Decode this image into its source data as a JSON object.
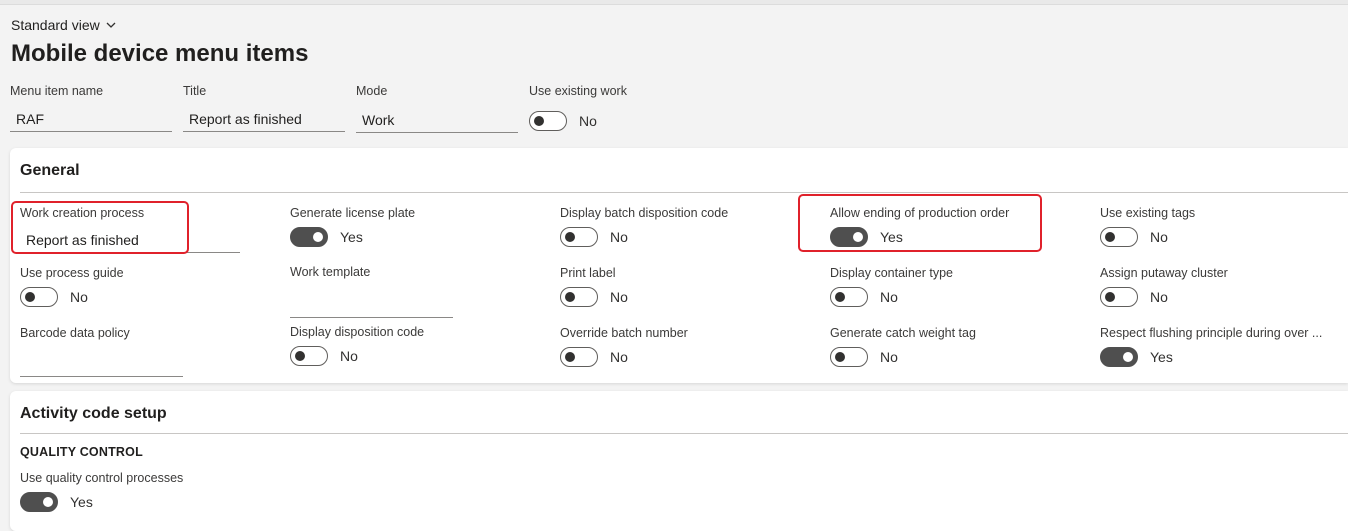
{
  "view": {
    "label": "Standard view"
  },
  "page": {
    "title": "Mobile device menu items"
  },
  "header": {
    "menu_item_name": {
      "label": "Menu item name",
      "value": "RAF"
    },
    "title": {
      "label": "Title",
      "value": "Report as finished"
    },
    "mode": {
      "label": "Mode",
      "value": "Work"
    },
    "use_existing_work": {
      "label": "Use existing work",
      "value": "No",
      "on": false
    }
  },
  "general": {
    "title": "General",
    "fields": [
      {
        "label": "Work creation process",
        "value": "Report as finished",
        "type": "text"
      },
      {
        "label": "Generate license plate",
        "value": "Yes",
        "type": "toggle",
        "on": true
      },
      {
        "label": "Display batch disposition code",
        "value": "No",
        "type": "toggle",
        "on": false
      },
      {
        "label": "Allow ending of production order",
        "value": "Yes",
        "type": "toggle",
        "on": true
      },
      {
        "label": "Use existing tags",
        "value": "No",
        "type": "toggle",
        "on": false
      },
      {
        "label": "Use process guide",
        "value": "No",
        "type": "toggle",
        "on": false
      },
      {
        "label": "Work template",
        "value": "",
        "type": "text"
      },
      {
        "label": "Print label",
        "value": "No",
        "type": "toggle",
        "on": false
      },
      {
        "label": "Display container type",
        "value": "No",
        "type": "toggle",
        "on": false
      },
      {
        "label": "Assign putaway cluster",
        "value": "No",
        "type": "toggle",
        "on": false
      },
      {
        "label": "Barcode data policy",
        "value": "",
        "type": "text"
      },
      {
        "label": "Display disposition code",
        "value": "No",
        "type": "toggle",
        "on": false
      },
      {
        "label": "Override batch number",
        "value": "No",
        "type": "toggle",
        "on": false
      },
      {
        "label": "Generate catch weight tag",
        "value": "No",
        "type": "toggle",
        "on": false
      },
      {
        "label": "Respect flushing principle during over ...",
        "value": "Yes",
        "type": "toggle",
        "on": true
      }
    ]
  },
  "activity": {
    "title": "Activity code setup",
    "section": "QUALITY CONTROL",
    "use_quality_control": {
      "label": "Use quality control processes",
      "value": "Yes",
      "on": true
    }
  },
  "colors": {
    "highlight": "#e0212b",
    "toggle_on": "#4f4f4f",
    "card_bg": "#ffffff",
    "page_bg": "#f3f3f3"
  }
}
